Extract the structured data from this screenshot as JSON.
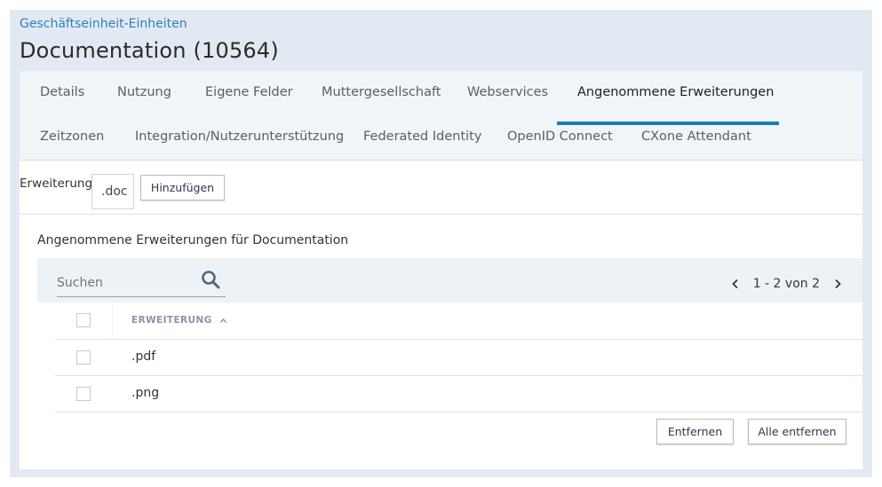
{
  "breadcrumb": "Geschäftseinheit-Einheiten",
  "page_title": "Documentation (10564)",
  "tabs_row1": [
    "Details",
    "Nutzung",
    "Eigene Felder",
    "Muttergesellschaft",
    "Webservices",
    "Angenommene Erweiterungen"
  ],
  "tabs_row2": [
    "Zeitzonen",
    "Integration/Nutzerunterstützung",
    "Federated Identity",
    "OpenID Connect",
    "CXone Attendant"
  ],
  "active_tab": "Angenommene Erweiterungen",
  "extension_form": {
    "label": "Erweiterung",
    "value": ".doc",
    "add_button": "Hinzufügen"
  },
  "section_title": "Angenommene Erweiterungen für Documentation",
  "search": {
    "placeholder": "Suchen"
  },
  "pagination": {
    "text": "1 - 2 von 2"
  },
  "table": {
    "column_header": "ERWEITERUNG",
    "sort_indicator": "^",
    "rows": [
      ".pdf",
      ".png"
    ]
  },
  "actions": {
    "remove": "Entfernen",
    "remove_all": "Alle entfernen"
  },
  "colors": {
    "accent": "#1a7bb7",
    "link": "#2f7fc1",
    "frame_bg": "#e2e9f2",
    "tab_bg": "#f0f5f8"
  },
  "icons": [
    "search-icon",
    "chevron-left-icon",
    "chevron-right-icon",
    "sort-asc-icon"
  ]
}
